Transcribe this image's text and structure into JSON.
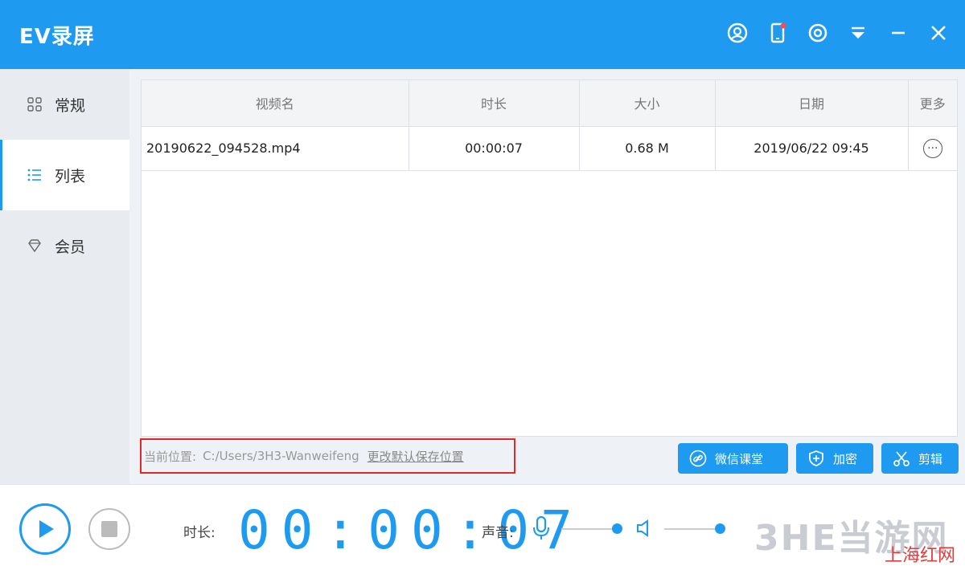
{
  "app": {
    "title": "EV录屏"
  },
  "sidebar": {
    "items": [
      {
        "label": "常规",
        "icon": "grid-icon"
      },
      {
        "label": "列表",
        "icon": "list-icon",
        "active": true
      },
      {
        "label": "会员",
        "icon": "diamond-icon"
      }
    ]
  },
  "table": {
    "headers": [
      "视频名",
      "时长",
      "大小",
      "日期",
      "更多"
    ],
    "rows": [
      {
        "name": "20190622_094528.mp4",
        "duration": "00:00:07",
        "size": "0.68 M",
        "date": "2019/06/22 09:45",
        "more": "···"
      }
    ]
  },
  "path": {
    "label": "当前位置:",
    "value": "C:/Users/3H3-Wanweifeng",
    "change_link": "更改默认保存位置"
  },
  "actions": {
    "wechat": "微信课堂",
    "encrypt": "加密",
    "cut": "剪辑"
  },
  "bottom": {
    "duration_label": "时长:",
    "timer": "00:00:07",
    "sound_label": "声音:",
    "mic_level": 1.0,
    "speaker_level": 1.0
  },
  "watermark": {
    "main": "3HE当游网",
    "sub": "上海红网"
  },
  "colors": {
    "accent": "#1e9bf0",
    "highlight_border": "#e02a2a"
  }
}
